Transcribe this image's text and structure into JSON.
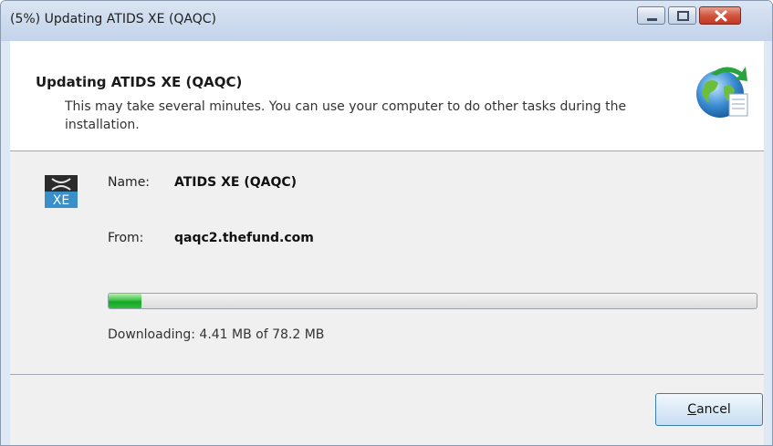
{
  "window": {
    "title": "(5%) Updating ATIDS XE (QAQC)"
  },
  "header": {
    "title": "Updating ATIDS XE (QAQC)",
    "description": "This may take several minutes. You can use your computer to do other tasks during the installation.",
    "icon": "globe-update-icon"
  },
  "details": {
    "name_label": "Name:",
    "name_value": "ATIDS XE (QAQC)",
    "from_label": "From:",
    "from_value": "qaqc2.thefund.com",
    "app_icon": "atids-xe-icon",
    "app_icon_text": "XE"
  },
  "progress": {
    "percent": 5,
    "status": "Downloading: 4.41 MB of 78.2 MB"
  },
  "footer": {
    "cancel_label_accel": "C",
    "cancel_label_rest": "ancel"
  },
  "colors": {
    "progress_fill": "#17a626",
    "close_button": "#c03a25"
  }
}
